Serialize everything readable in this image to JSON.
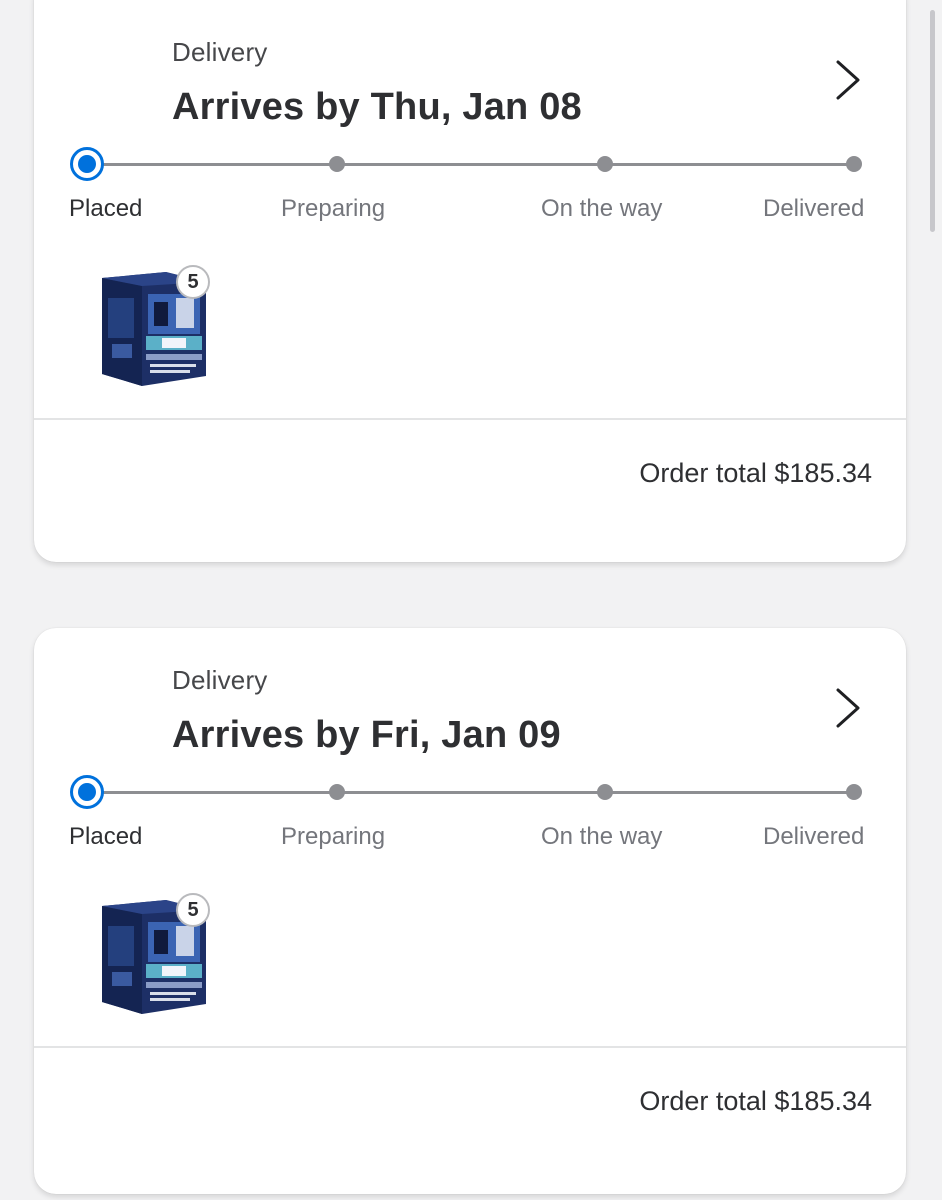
{
  "orders": [
    {
      "fulfillment_label": "Delivery",
      "arrival_title": "Arrives by Thu, Jan 08",
      "steps": [
        "Placed",
        "Preparing",
        "On the way",
        "Delivered"
      ],
      "current_step": 0,
      "item_quantity": "5",
      "item_icon": "trading-card-box",
      "order_total": "Order total $185.34"
    },
    {
      "fulfillment_label": "Delivery",
      "arrival_title": "Arrives by Fri, Jan 09",
      "steps": [
        "Placed",
        "Preparing",
        "On the way",
        "Delivered"
      ],
      "current_step": 0,
      "item_quantity": "5",
      "item_icon": "trading-card-box",
      "order_total": "Order total $185.34"
    }
  ],
  "colors": {
    "accent": "#0071dc",
    "track": "#8d8e92",
    "text_primary": "#2e2f32",
    "text_muted": "#74767c",
    "background": "#f2f2f3",
    "card": "#ffffff"
  }
}
